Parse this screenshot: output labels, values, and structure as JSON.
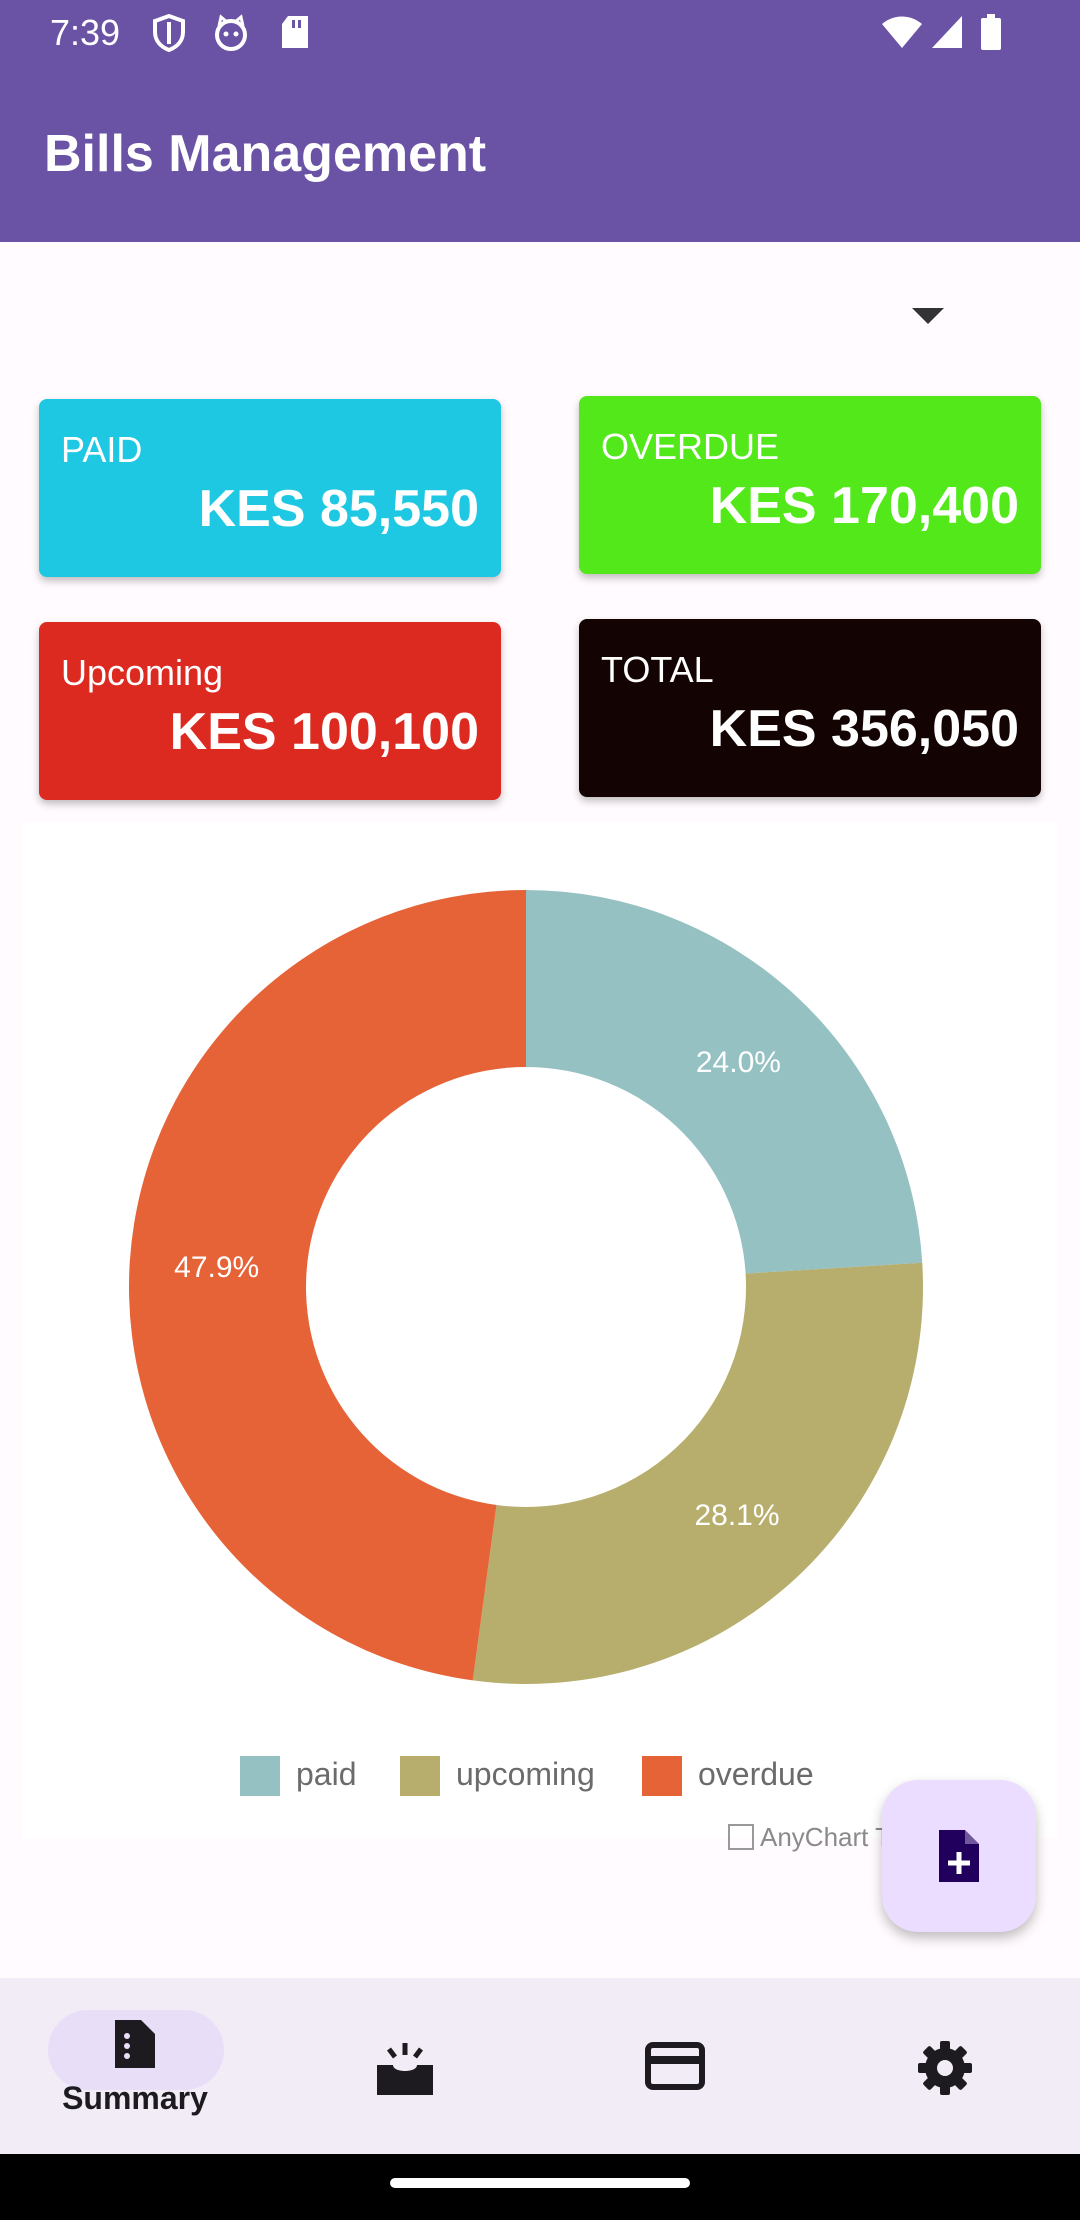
{
  "status_bar": {
    "time": "7:39",
    "left_icons": [
      "shield-icon",
      "cat-icon",
      "sd-card-icon"
    ],
    "right_icons": [
      "wifi-icon",
      "signal-icon",
      "battery-icon"
    ]
  },
  "app_bar": {
    "title": "Bills Management",
    "color": "#6a52a4"
  },
  "filter_dropdown": {
    "selected": "",
    "icon": "dropdown-arrow-icon"
  },
  "cards": {
    "paid": {
      "label": "PAID",
      "value": "KES 85,550",
      "color": "#1ec8e2"
    },
    "overdue": {
      "label": "OVERDUE",
      "value": "KES 170,400",
      "color": "#52e81a"
    },
    "upcoming": {
      "label": "Upcoming",
      "value": "KES 100,100",
      "color": "#dc2a21"
    },
    "total": {
      "label": "TOTAL",
      "value": "KES 356,050",
      "color": "#140303"
    }
  },
  "chart_data": {
    "type": "pie",
    "donut": true,
    "categories": [
      "paid",
      "upcoming",
      "overdue"
    ],
    "values": [
      85550,
      100100,
      170400
    ],
    "labels": [
      "24.0%",
      "28.1%",
      "47.9%"
    ],
    "colors": [
      "#96c1c2",
      "#b7ae6d",
      "#e66338"
    ],
    "legend": "bottom",
    "credits": "AnyChart T"
  },
  "fab": {
    "icon": "add-document-icon"
  },
  "bottom_nav": {
    "items": [
      {
        "label": "Summary",
        "icon": "summary-document-icon",
        "active": true
      },
      {
        "label": "",
        "icon": "inbox-icon",
        "active": false
      },
      {
        "label": "",
        "icon": "credit-card-icon",
        "active": false
      },
      {
        "label": "",
        "icon": "settings-gear-icon",
        "active": false
      }
    ]
  }
}
